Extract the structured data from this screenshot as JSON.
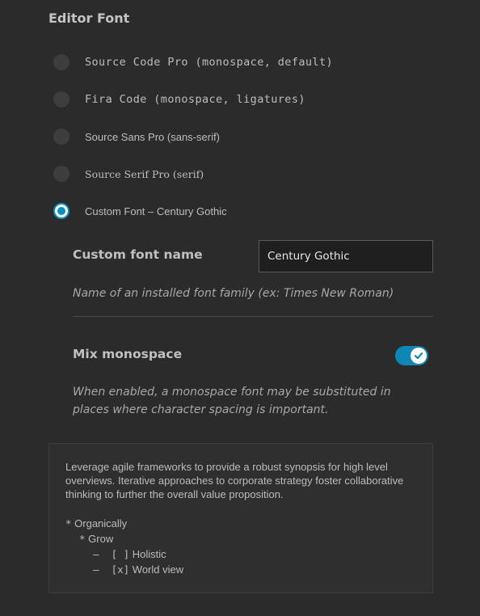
{
  "section": {
    "title": "Editor Font"
  },
  "fonts": [
    {
      "label": "Source Code Pro (monospace, default)",
      "selected": false,
      "style": "mono"
    },
    {
      "label": "Fira Code (monospace, ligatures)",
      "selected": false,
      "style": "mono"
    },
    {
      "label": "Source Sans Pro (sans-serif)",
      "selected": false,
      "style": "sans"
    },
    {
      "label": "Source Serif Pro (serif)",
      "selected": false,
      "style": "serif"
    },
    {
      "label": "Custom Font – Century Gothic",
      "selected": true,
      "style": "sans"
    }
  ],
  "custom_font": {
    "label": "Custom font name",
    "value": "Century Gothic",
    "hint": "Name of an installed font family (ex: Times New Roman)"
  },
  "mix_monospace": {
    "label": "Mix monospace",
    "enabled": true,
    "hint": "When enabled, a monospace font may be substituted in places where character spacing is important."
  },
  "preview": {
    "paragraph": "Leverage agile frameworks to provide a robust synopsis for high level overviews. Iterative approaches to corporate strategy foster collaborative thinking to further the overall value proposition.",
    "list": {
      "item1_marker": "*",
      "item1": "Organically",
      "item2_marker": "*",
      "item2": "Grow",
      "item3_marker": "–  [ ]",
      "item3": "Holistic",
      "item4_marker": "–  [x]",
      "item4": "World view"
    }
  },
  "colors": {
    "background": "#2b2b2b",
    "accent": "#0e87b6",
    "text": "#c8c8c8"
  }
}
